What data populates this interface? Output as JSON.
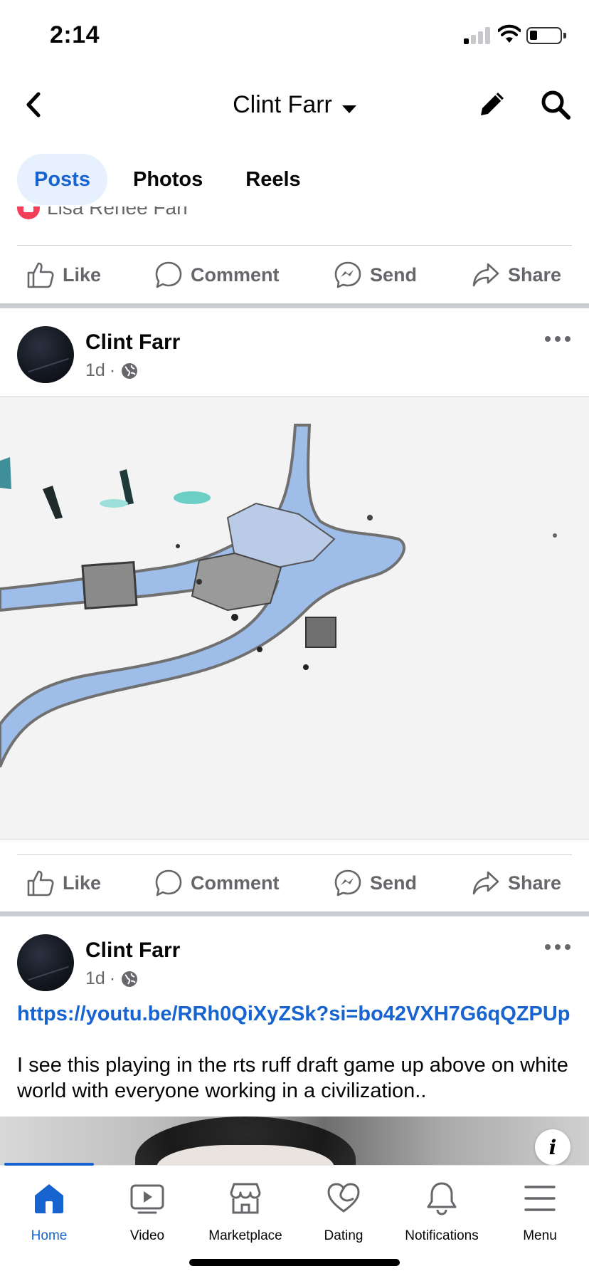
{
  "status_bar": {
    "time": "2:14"
  },
  "header": {
    "title": "Clint Farr"
  },
  "tabs": [
    {
      "label": "Posts",
      "active": true
    },
    {
      "label": "Photos",
      "active": false
    },
    {
      "label": "Reels",
      "active": false
    }
  ],
  "reaction_row": {
    "name": "Lisa Renee Farr"
  },
  "actions": {
    "like": "Like",
    "comment": "Comment",
    "send": "Send",
    "share": "Share"
  },
  "posts": [
    {
      "author": "Clint Farr",
      "time": "1d",
      "separator": "·",
      "privacy_icon": "globe-icon"
    },
    {
      "author": "Clint Farr",
      "time": "1d",
      "separator": "·",
      "privacy_icon": "globe-icon",
      "link": "https://youtu.be/RRh0QiXyZSk?si=bo42VXH7G6qQZPUp",
      "text": "I see this playing in the rts ruff draft game up above on white world with everyone working in a civilization.."
    }
  ],
  "info_button": "i",
  "bottom_nav": [
    {
      "label": "Home",
      "icon": "home-icon",
      "active": true
    },
    {
      "label": "Video",
      "icon": "video-icon",
      "active": false
    },
    {
      "label": "Marketplace",
      "icon": "marketplace-icon",
      "active": false
    },
    {
      "label": "Dating",
      "icon": "dating-icon",
      "active": false
    },
    {
      "label": "Notifications",
      "icon": "bell-icon",
      "active": false
    },
    {
      "label": "Menu",
      "icon": "menu-icon",
      "active": false
    }
  ],
  "colors": {
    "accent": "#1763cf",
    "secondary_text": "#65676b",
    "divider": "#ced0d4"
  }
}
